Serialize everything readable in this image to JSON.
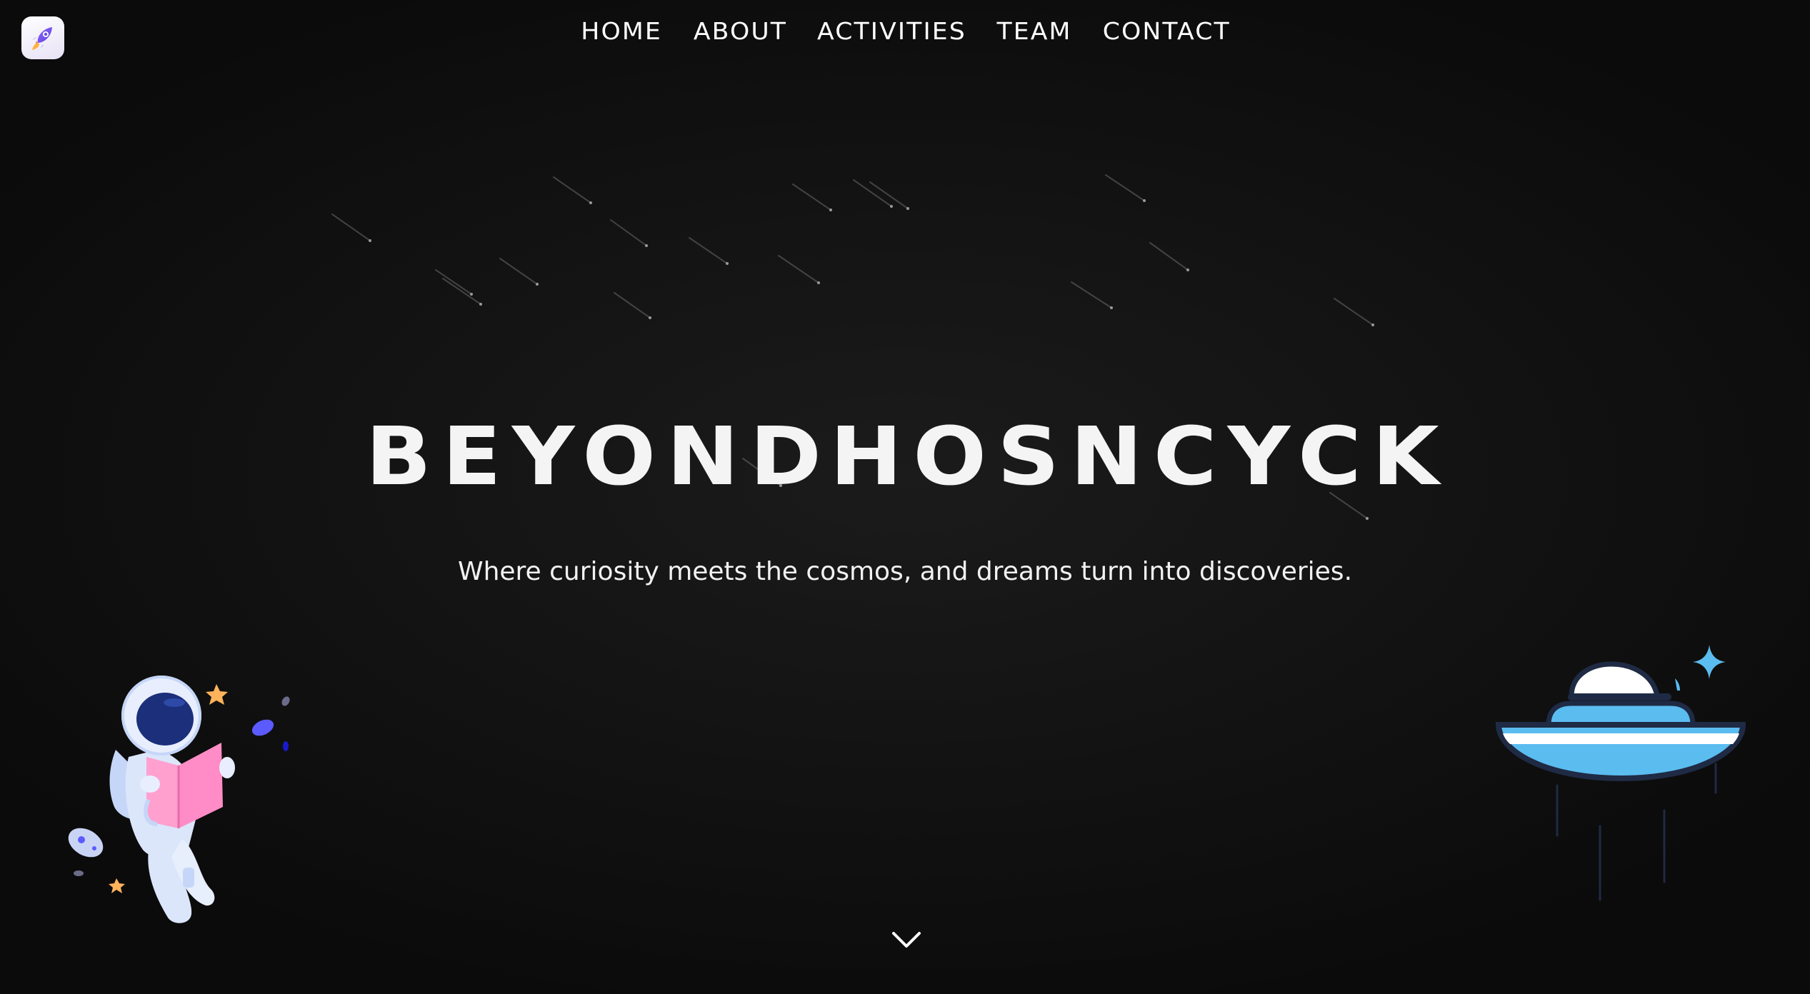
{
  "brand": {
    "logo_icon": "rocket-icon"
  },
  "nav": {
    "items": [
      {
        "label": "HOME"
      },
      {
        "label": "ABOUT"
      },
      {
        "label": "ACTIVITIES"
      },
      {
        "label": "TEAM"
      },
      {
        "label": "CONTACT"
      }
    ]
  },
  "hero": {
    "title_part1": "BEYOND",
    "title_part2": "HOSNCYCK",
    "tagline": "Where curiosity meets the cosmos, and dreams turn into discoveries."
  },
  "scroll": {
    "icon": "chevron-down-icon"
  },
  "illustrations": {
    "left": "astronaut-reading-illustration",
    "right": "ufo-illustration"
  },
  "colors": {
    "background": "#111111",
    "text": "#ffffff",
    "ufo_blue": "#5bbcf0",
    "ufo_outline": "#1f2a44",
    "astronaut_suit": "#dbe6fb",
    "book_pink": "#ff8cc6",
    "visor": "#1b2f7a"
  }
}
